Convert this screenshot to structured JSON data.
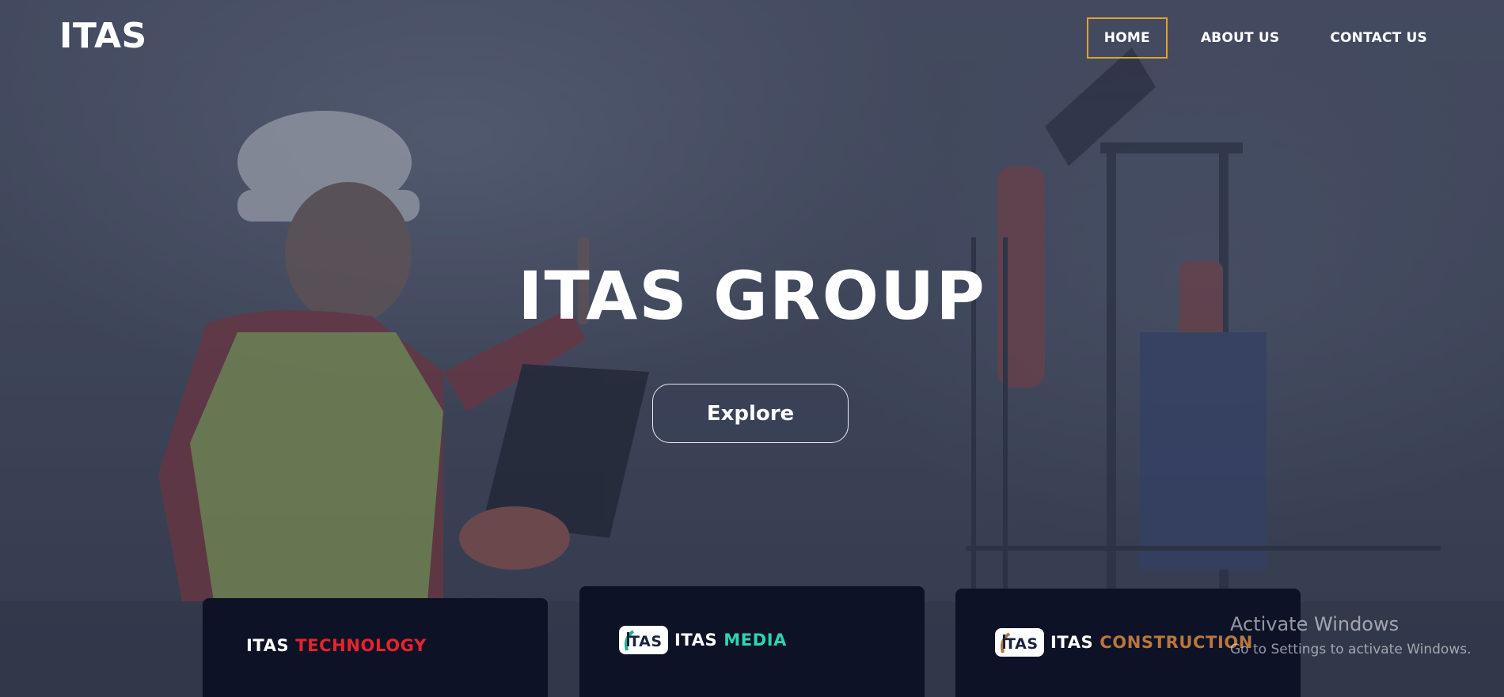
{
  "brand": {
    "logo_text": "ITAS"
  },
  "nav": {
    "items": [
      {
        "label": "HOME",
        "active": true
      },
      {
        "label": "ABOUT US",
        "active": false
      },
      {
        "label": "CONTACT US",
        "active": false
      }
    ]
  },
  "hero": {
    "title": "ITAS GROUP",
    "cta_label": "Explore"
  },
  "cards": [
    {
      "prefix": "ITAS",
      "accent": "TECHNOLOGY",
      "accent_color": "#e8232a",
      "has_logo": false
    },
    {
      "prefix": "ITAS",
      "accent": "MEDIA",
      "accent_color": "#2fd3b1",
      "has_logo": true,
      "logo_icon": "itas-logo-icon"
    },
    {
      "prefix": "ITAS",
      "accent": "CONSTRUCTION",
      "accent_color": "#b7773d",
      "has_logo": true,
      "logo_icon": "itas-logo-icon"
    }
  ],
  "watermark": {
    "title": "Activate Windows",
    "subtitle": "Go to Settings to activate Windows."
  },
  "colors": {
    "nav_active_border": "#e0a32f",
    "card_bg": "#0d1226"
  }
}
